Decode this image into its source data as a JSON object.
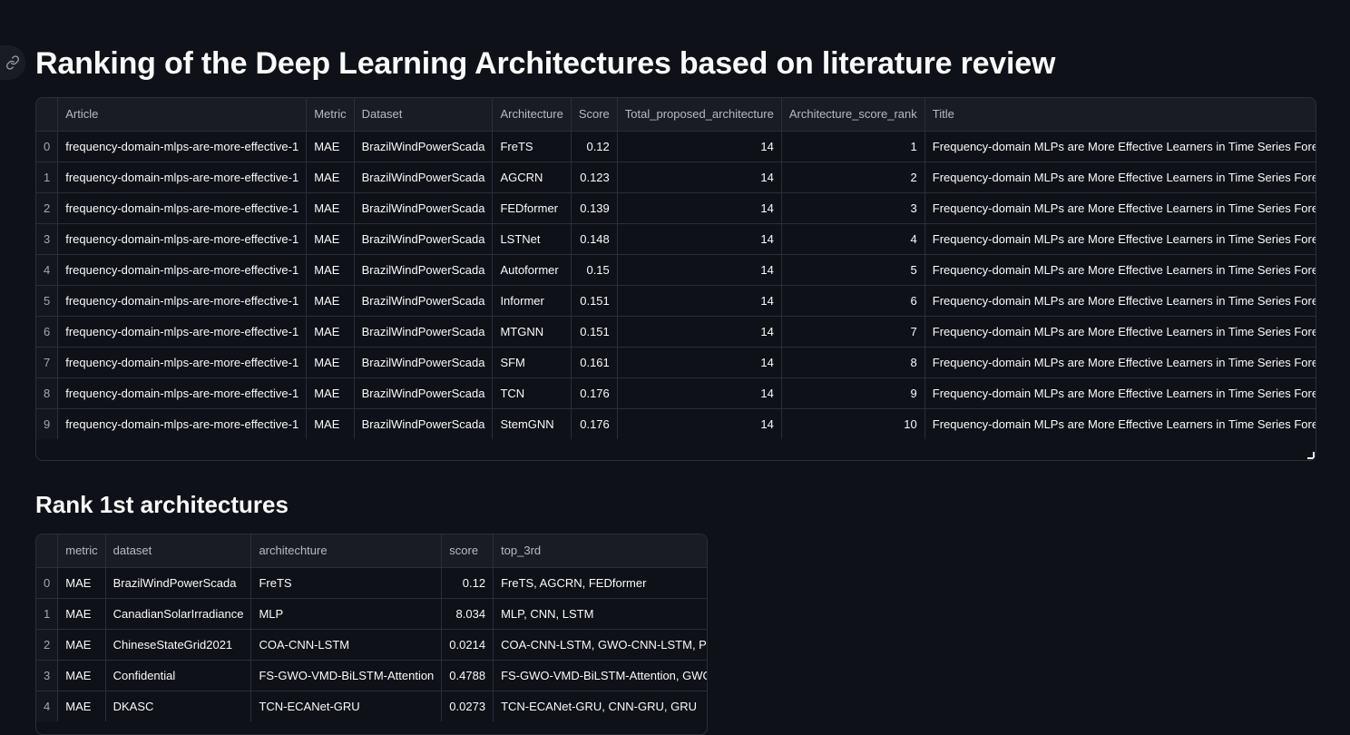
{
  "page": {
    "title": "Ranking of the Deep Learning Architectures based on literature review",
    "subtitle": "Rank 1st architectures"
  },
  "table1": {
    "columns": [
      "",
      "Article",
      "Metric",
      "Dataset",
      "Architecture",
      "Score",
      "Total_proposed_architecture",
      "Architecture_score_rank",
      "Title"
    ],
    "rows": [
      [
        "0",
        "frequency-domain-mlps-are-more-effective-1",
        "MAE",
        "BrazilWindPowerScada",
        "FreTS",
        "0.12",
        "14",
        "1",
        "Frequency-domain MLPs are More Effective Learners in Time Series Forecasting"
      ],
      [
        "1",
        "frequency-domain-mlps-are-more-effective-1",
        "MAE",
        "BrazilWindPowerScada",
        "AGCRN",
        "0.123",
        "14",
        "2",
        "Frequency-domain MLPs are More Effective Learners in Time Series Forecasting"
      ],
      [
        "2",
        "frequency-domain-mlps-are-more-effective-1",
        "MAE",
        "BrazilWindPowerScada",
        "FEDformer",
        "0.139",
        "14",
        "3",
        "Frequency-domain MLPs are More Effective Learners in Time Series Forecasting"
      ],
      [
        "3",
        "frequency-domain-mlps-are-more-effective-1",
        "MAE",
        "BrazilWindPowerScada",
        "LSTNet",
        "0.148",
        "14",
        "4",
        "Frequency-domain MLPs are More Effective Learners in Time Series Forecasting"
      ],
      [
        "4",
        "frequency-domain-mlps-are-more-effective-1",
        "MAE",
        "BrazilWindPowerScada",
        "Autoformer",
        "0.15",
        "14",
        "5",
        "Frequency-domain MLPs are More Effective Learners in Time Series Forecasting"
      ],
      [
        "5",
        "frequency-domain-mlps-are-more-effective-1",
        "MAE",
        "BrazilWindPowerScada",
        "Informer",
        "0.151",
        "14",
        "6",
        "Frequency-domain MLPs are More Effective Learners in Time Series Forecasting"
      ],
      [
        "6",
        "frequency-domain-mlps-are-more-effective-1",
        "MAE",
        "BrazilWindPowerScada",
        "MTGNN",
        "0.151",
        "14",
        "7",
        "Frequency-domain MLPs are More Effective Learners in Time Series Forecasting"
      ],
      [
        "7",
        "frequency-domain-mlps-are-more-effective-1",
        "MAE",
        "BrazilWindPowerScada",
        "SFM",
        "0.161",
        "14",
        "8",
        "Frequency-domain MLPs are More Effective Learners in Time Series Forecasting"
      ],
      [
        "8",
        "frequency-domain-mlps-are-more-effective-1",
        "MAE",
        "BrazilWindPowerScada",
        "TCN",
        "0.176",
        "14",
        "9",
        "Frequency-domain MLPs are More Effective Learners in Time Series Forecasting"
      ],
      [
        "9",
        "frequency-domain-mlps-are-more-effective-1",
        "MAE",
        "BrazilWindPowerScada",
        "StemGNN",
        "0.176",
        "14",
        "10",
        "Frequency-domain MLPs are More Effective Learners in Time Series Forecasting"
      ]
    ]
  },
  "table2": {
    "columns": [
      "",
      "metric",
      "dataset",
      "architechture",
      "score",
      "top_3rd"
    ],
    "rows": [
      [
        "0",
        "MAE",
        "BrazilWindPowerScada",
        "FreTS",
        "0.12",
        "FreTS, AGCRN, FEDformer"
      ],
      [
        "1",
        "MAE",
        "CanadianSolarIrradiance",
        "MLP",
        "8.034",
        "MLP, CNN, LSTM"
      ],
      [
        "2",
        "MAE",
        "ChineseStateGrid2021",
        "COA-CNN-LSTM",
        "0.0214",
        "COA-CNN-LSTM, GWO-CNN-LSTM, PSO-CNN-LSTM"
      ],
      [
        "3",
        "MAE",
        "Confidential",
        "FS-GWO-VMD-BiLSTM-Attention",
        "0.4788",
        "FS-GWO-VMD-BiLSTM-Attention, GWO-VMD-BiLSTM"
      ],
      [
        "4",
        "MAE",
        "DKASC",
        "TCN-ECANet-GRU",
        "0.0273",
        "TCN-ECANet-GRU, CNN-GRU, GRU"
      ]
    ]
  }
}
